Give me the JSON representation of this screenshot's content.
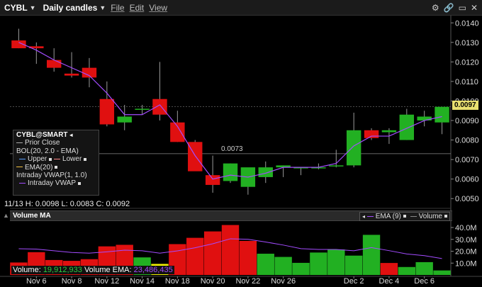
{
  "toolbar": {
    "symbol": "CYBL",
    "interval": "Daily candles",
    "menus": [
      "File",
      "Edit",
      "View"
    ]
  },
  "price_axis": {
    "labels": [
      "0.0140",
      "0.0130",
      "0.0120",
      "0.0110",
      "0.0100",
      "0.0090",
      "0.0080",
      "0.0070",
      "0.0060",
      "0.0050"
    ],
    "values": [
      0.014,
      0.013,
      0.012,
      0.011,
      0.01,
      0.009,
      0.008,
      0.007,
      0.006,
      0.005
    ],
    "current_price": "0.0097",
    "prior_close_label": "0.0073",
    "prior_close": 0.0073
  },
  "legend": {
    "title": "CYBL@SMART",
    "prior_close": "Prior Close",
    "bollinger": "BOL(20, 2.0 - EMA)",
    "upper": "Upper",
    "lower": "Lower",
    "ema": "EMA(20)",
    "vwap": "Intraday VWAP(1, 1.0)",
    "vwap_line": "Intraday VWAP"
  },
  "ohlc": "11/13 H: 0.0098 L: 0.0083 C: 0.0092",
  "volume_panel": {
    "title": "Volume MA",
    "legend_ema": "EMA (9)",
    "legend_volume": "Volume",
    "axis_labels": [
      "40.0M",
      "30.0M",
      "20.0M",
      "10.0M"
    ],
    "footer_volume_label": "Volume:",
    "footer_volume_value": "19,912,933",
    "footer_ema_label": "Volume EMA:",
    "footer_ema_value": "23,486,435"
  },
  "x_axis_labels": [
    "Nov 6",
    "Nov 8",
    "Nov 12",
    "Nov 14",
    "Nov 18",
    "Nov 20",
    "Nov 22",
    "Nov 26",
    "Dec 2",
    "Dec 4",
    "Dec 6"
  ],
  "colors": {
    "up": "#22b022",
    "down": "#e01010",
    "neutral": "#f0f000",
    "ema": "#a34cff",
    "current": "#e8e070"
  },
  "chart_data": {
    "type": "candlestick",
    "candles": [
      {
        "o": 0.0131,
        "h": 0.0137,
        "l": 0.0127,
        "c": 0.0127
      },
      {
        "o": 0.0128,
        "h": 0.013,
        "l": 0.0119,
        "c": 0.0127
      },
      {
        "o": 0.0121,
        "h": 0.0127,
        "l": 0.0115,
        "c": 0.0117
      },
      {
        "o": 0.0114,
        "h": 0.0125,
        "l": 0.0112,
        "c": 0.0113
      },
      {
        "o": 0.0117,
        "h": 0.0122,
        "l": 0.0107,
        "c": 0.0112
      },
      {
        "o": 0.0101,
        "h": 0.011,
        "l": 0.0087,
        "c": 0.0088
      },
      {
        "o": 0.0089,
        "h": 0.0098,
        "l": 0.0085,
        "c": 0.0092
      },
      {
        "o": 0.0096,
        "h": 0.0098,
        "l": 0.0093,
        "c": 0.0096
      },
      {
        "o": 0.0101,
        "h": 0.012,
        "l": 0.009,
        "c": 0.0093
      },
      {
        "o": 0.0089,
        "h": 0.0095,
        "l": 0.0079,
        "c": 0.0079
      },
      {
        "o": 0.0079,
        "h": 0.008,
        "l": 0.0066,
        "c": 0.0064
      },
      {
        "o": 0.0062,
        "h": 0.0072,
        "l": 0.0053,
        "c": 0.0057
      },
      {
        "o": 0.0059,
        "h": 0.0068,
        "l": 0.0058,
        "c": 0.0068
      },
      {
        "o": 0.0056,
        "h": 0.0063,
        "l": 0.0052,
        "c": 0.0066
      },
      {
        "o": 0.0061,
        "h": 0.0069,
        "l": 0.0058,
        "c": 0.0066
      },
      {
        "o": 0.0066,
        "h": 0.0067,
        "l": 0.0061,
        "c": 0.0067
      },
      {
        "o": 0.0066,
        "h": 0.0066,
        "l": 0.0062,
        "c": 0.0066
      },
      {
        "o": 0.0066,
        "h": 0.0068,
        "l": 0.0065,
        "c": 0.0066
      },
      {
        "o": 0.0067,
        "h": 0.0075,
        "l": 0.0066,
        "c": 0.0067
      },
      {
        "o": 0.0067,
        "h": 0.0094,
        "l": 0.0066,
        "c": 0.0085
      },
      {
        "o": 0.0085,
        "h": 0.0086,
        "l": 0.008,
        "c": 0.0081
      },
      {
        "o": 0.0084,
        "h": 0.0086,
        "l": 0.0078,
        "c": 0.0085
      },
      {
        "o": 0.008,
        "h": 0.0096,
        "l": 0.008,
        "c": 0.0093
      },
      {
        "o": 0.009,
        "h": 0.0095,
        "l": 0.0087,
        "c": 0.0092
      },
      {
        "o": 0.0089,
        "h": 0.0097,
        "l": 0.0083,
        "c": 0.0097
      }
    ],
    "vwap": [
      0.013,
      0.0126,
      0.0121,
      0.0117,
      0.0113,
      0.0104,
      0.0093,
      0.0093,
      0.0098,
      0.0087,
      0.0072,
      0.006,
      0.0062,
      0.0061,
      0.0063,
      0.0066,
      0.0066,
      0.0066,
      0.0068,
      0.0077,
      0.0082,
      0.0082,
      0.0086,
      0.009,
      0.0092
    ],
    "volumes": [
      10.5,
      19.2,
      12.6,
      11.9,
      13.3,
      24.1,
      25.4,
      14.8,
      9.3,
      26.0,
      31.3,
      36.7,
      42.1,
      28.7,
      17.9,
      15.2,
      10.2,
      18.9,
      21.5,
      16.3,
      33.8,
      10.1,
      6.7,
      10.8,
      3.8
    ],
    "volume_colors": [
      "down",
      "down",
      "down",
      "down",
      "down",
      "down",
      "down",
      "up",
      "neutral",
      "down",
      "down",
      "down",
      "down",
      "down",
      "up",
      "up",
      "up",
      "up",
      "up",
      "up",
      "up",
      "down",
      "up",
      "up",
      "up"
    ],
    "volume_ema": [
      22.1,
      21.8,
      20.4,
      19.0,
      18.4,
      19.5,
      20.9,
      20.4,
      18.4,
      20.3,
      22.9,
      26.3,
      30.5,
      30.1,
      27.8,
      25.2,
      22.2,
      21.5,
      21.5,
      20.4,
      23.1,
      20.5,
      17.7,
      16.3,
      13.8
    ],
    "ylim_price": [
      0.0045,
      0.0143
    ],
    "ylim_volume": [
      0,
      46
    ]
  }
}
